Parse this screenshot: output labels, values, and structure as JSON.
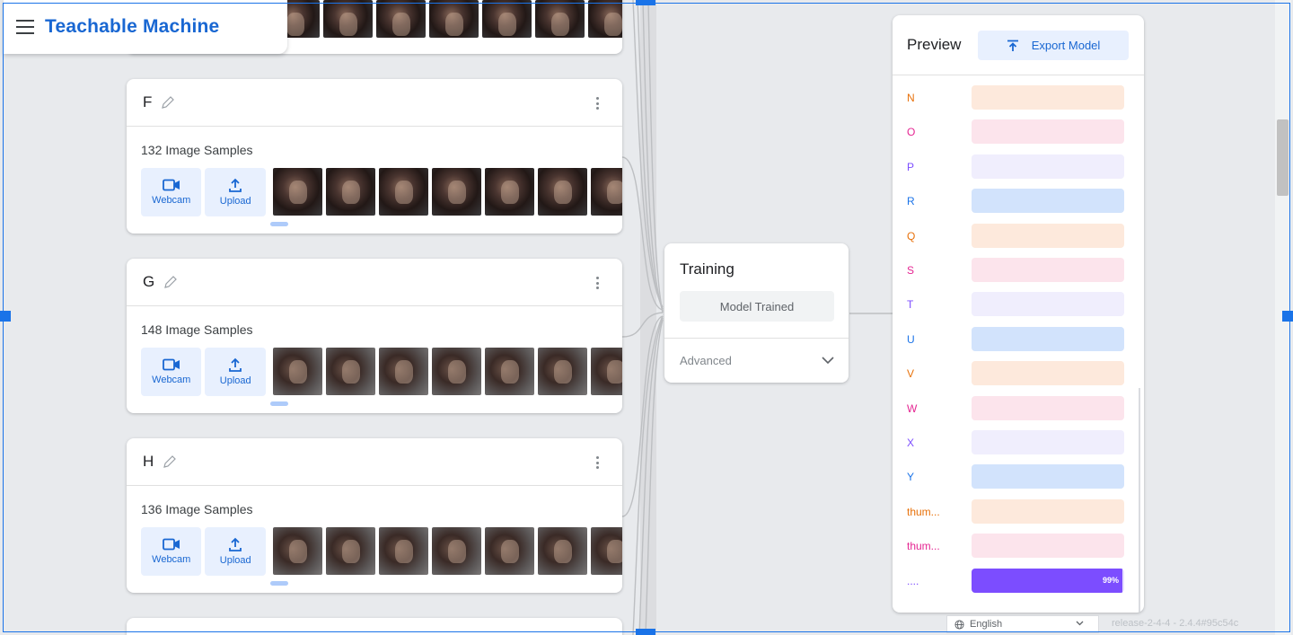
{
  "app": {
    "title": "Teachable Machine"
  },
  "classes_top_partial": {
    "thumbnails": 6
  },
  "classes": [
    {
      "name": "F",
      "samples": "132 Image Samples",
      "webcam_label": "Webcam",
      "upload_label": "Upload"
    },
    {
      "name": "G",
      "samples": "148 Image Samples",
      "webcam_label": "Webcam",
      "upload_label": "Upload"
    },
    {
      "name": "H",
      "samples": "136 Image Samples",
      "webcam_label": "Webcam",
      "upload_label": "Upload"
    }
  ],
  "training": {
    "title": "Training",
    "button_label": "Model Trained",
    "advanced_label": "Advanced"
  },
  "preview": {
    "title": "Preview",
    "export_label": "Export Model",
    "rows": [
      {
        "label": "N",
        "color": "#e8710a",
        "bg": "#fde9dc",
        "value": 0
      },
      {
        "label": "O",
        "color": "#e52592",
        "bg": "#fce4ec",
        "value": 0
      },
      {
        "label": "P",
        "color": "#7c4dff",
        "bg": "#f0eefd",
        "value": 0
      },
      {
        "label": "R",
        "color": "#1a73e8",
        "bg": "#d2e3fc",
        "value": 0
      },
      {
        "label": "Q",
        "color": "#e8710a",
        "bg": "#fde9dc",
        "value": 0
      },
      {
        "label": "S",
        "color": "#e52592",
        "bg": "#fce4ec",
        "value": 0
      },
      {
        "label": "T",
        "color": "#7c4dff",
        "bg": "#f0eefd",
        "value": 0
      },
      {
        "label": "U",
        "color": "#1a73e8",
        "bg": "#d2e3fc",
        "value": 0
      },
      {
        "label": "V",
        "color": "#e8710a",
        "bg": "#fde9dc",
        "value": 0
      },
      {
        "label": "W",
        "color": "#e52592",
        "bg": "#fce4ec",
        "value": 0
      },
      {
        "label": "X",
        "color": "#7c4dff",
        "bg": "#f0eefd",
        "value": 0
      },
      {
        "label": "Y",
        "color": "#1a73e8",
        "bg": "#d2e3fc",
        "value": 0
      },
      {
        "label": "thum...",
        "color": "#e8710a",
        "bg": "#fde9dc",
        "value": 0
      },
      {
        "label": "thum...",
        "color": "#e52592",
        "bg": "#fce4ec",
        "value": 0
      },
      {
        "label": "....",
        "color": "#7c4dff",
        "bg": "#7c4dff",
        "value": 0.99,
        "percent_label": "99%",
        "fill": "#7c4dff"
      }
    ]
  },
  "footer": {
    "language": "English",
    "release": "release-2-4-4 - 2.4.4#95c54c"
  },
  "icons": {
    "menu": "hamburger-icon",
    "edit": "pencil-icon",
    "more": "more-vert-icon",
    "webcam": "videocam-icon",
    "upload": "upload-icon",
    "export": "upload-arrow-icon",
    "advanced": "chevron-down-icon",
    "language": "globe-icon"
  },
  "colors": {
    "accent": "#1967d2",
    "accent_bg": "#e8f0fe",
    "selection": "#1a73e8"
  }
}
